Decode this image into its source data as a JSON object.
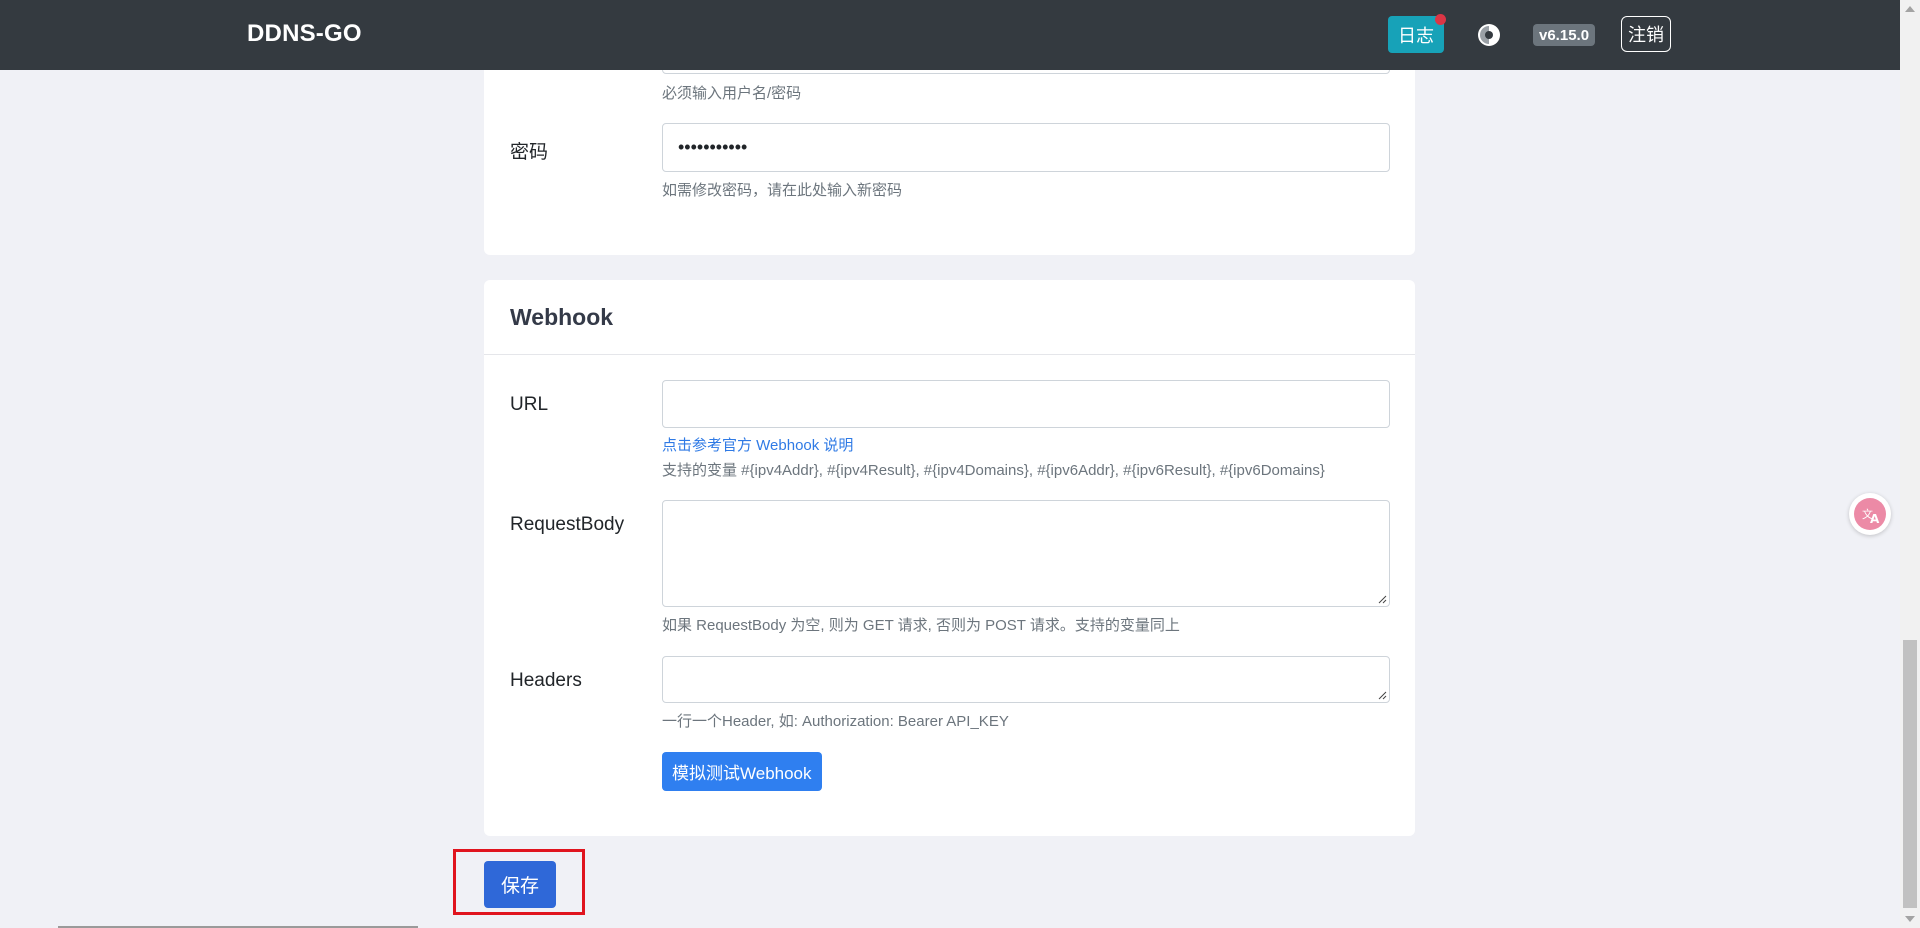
{
  "navbar": {
    "brand": "DDNS-GO",
    "log_label": "日志",
    "version": "v6.15.0",
    "logout_label": "注销",
    "theme_icon": "theme-toggle-icon"
  },
  "auth_section": {
    "username_help": "必须输入用户名/密码",
    "password_label": "密码",
    "password_value": "•••••••••••",
    "password_help": "如需修改密码，请在此处输入新密码"
  },
  "webhook": {
    "title": "Webhook",
    "url_label": "URL",
    "url_value": "",
    "url_doc_link": "点击参考官方 Webhook 说明",
    "url_help": "支持的变量 #{ipv4Addr}, #{ipv4Result}, #{ipv4Domains}, #{ipv6Addr}, #{ipv6Result}, #{ipv6Domains}",
    "body_label": "RequestBody",
    "body_value": "",
    "body_help": "如果 RequestBody 为空, 则为 GET 请求, 否则为 POST 请求。支持的变量同上",
    "headers_label": "Headers",
    "headers_value": "",
    "headers_help": "一行一个Header, 如: Authorization: Bearer API_KEY",
    "test_button": "模拟测试Webhook"
  },
  "save_button": "保存",
  "colors": {
    "navbar": "#343a40",
    "log_button": "#17a2b8",
    "primary": "#2f7ff0",
    "highlight": "#e0141e"
  }
}
